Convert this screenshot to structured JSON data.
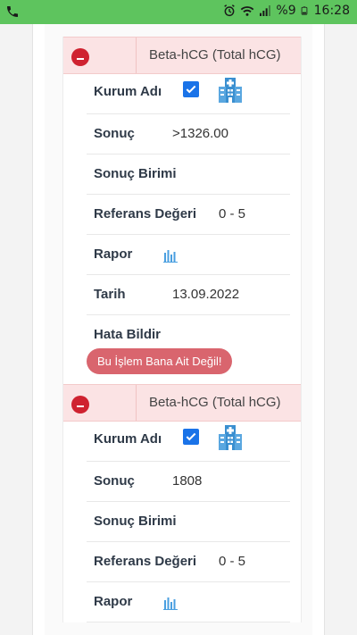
{
  "status_bar": {
    "time": "16:28",
    "battery": "%9"
  },
  "cards": [
    {
      "title": "Beta-hCG (Total hCG)",
      "rows": {
        "kurum_adi": "Kurum Adı",
        "sonuc_label": "Sonuç",
        "sonuc_value": ">1326.00",
        "sonuc_birimi": "Sonuç Birimi",
        "referans_label": "Referans Değeri",
        "referans_value": "0 - 5",
        "rapor": "Rapor",
        "tarih_label": "Tarih",
        "tarih_value": "13.09.2022",
        "hata_label": "Hata Bildir",
        "hata_button": "Bu İşlem Bana Ait Değil!"
      }
    },
    {
      "title": "Beta-hCG (Total hCG)",
      "rows": {
        "kurum_adi": "Kurum Adı",
        "sonuc_label": "Sonuç",
        "sonuc_value": "1808",
        "sonuc_birimi": "Sonuç Birimi",
        "referans_label": "Referans Değeri",
        "referans_value": "0 - 5",
        "rapor": "Rapor"
      }
    }
  ],
  "colors": {
    "status_bar": "#5ec45e",
    "header_bg": "#fbe3e4",
    "minus_red": "#cf2230",
    "checkbox_blue": "#1a73e8",
    "hospital_blue": "#3a8fd0",
    "pill_red": "#d9656e"
  },
  "icons": [
    "phone-icon",
    "alarm-icon",
    "wifi-icon",
    "signal-icon",
    "battery-icon",
    "minus-circle-icon",
    "checkbox-icon",
    "hospital-icon",
    "bar-chart-icon"
  ]
}
